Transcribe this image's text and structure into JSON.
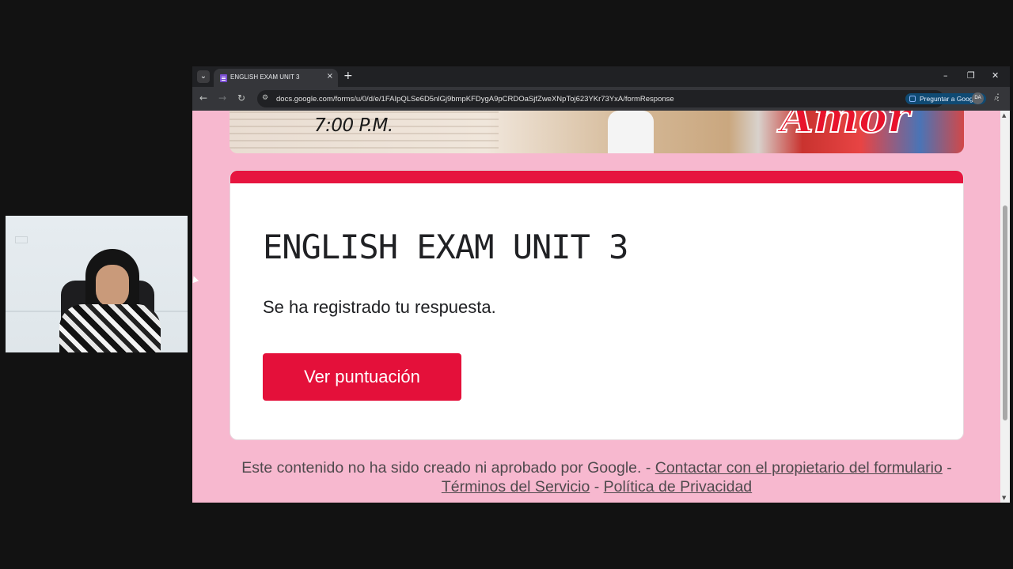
{
  "tab": {
    "title": "ENGLISH EXAM UNIT 3",
    "close": "×",
    "new_tab": "+"
  },
  "window_controls": {
    "minimize": "–",
    "restore": "❐",
    "close": "✕"
  },
  "toolbar": {
    "back": "←",
    "forward": "→",
    "reload": "↻",
    "url": "docs.google.com/forms/u/0/d/e/1FAIpQLSe6D5nlGj9bmpKFDygA9pCRDOaSjfZweXNpToj623YKr73YxA/formResponse",
    "ask_google": "Preguntar a Google",
    "avatar_initials": "DA"
  },
  "banner": {
    "time_text": "7:00 P.M.",
    "script_text": "Amor"
  },
  "form": {
    "title": "ENGLISH EXAM UNIT 3",
    "confirmation": "Se ha registrado tu respuesta.",
    "view_score_button": "Ver puntuación",
    "accent_color": "#e6153f"
  },
  "footer": {
    "disclaimer": "Este contenido no ha sido creado ni aprobado por Google. - ",
    "contact_link": "Contactar con el propietario del formulario",
    "sep1": " - ",
    "terms_link": "Términos del Servicio",
    "sep2": " - ",
    "privacy_link": "Política de Privacidad"
  },
  "scrollbar": {
    "up": "▲",
    "down": "▼",
    "position": 0.32
  }
}
